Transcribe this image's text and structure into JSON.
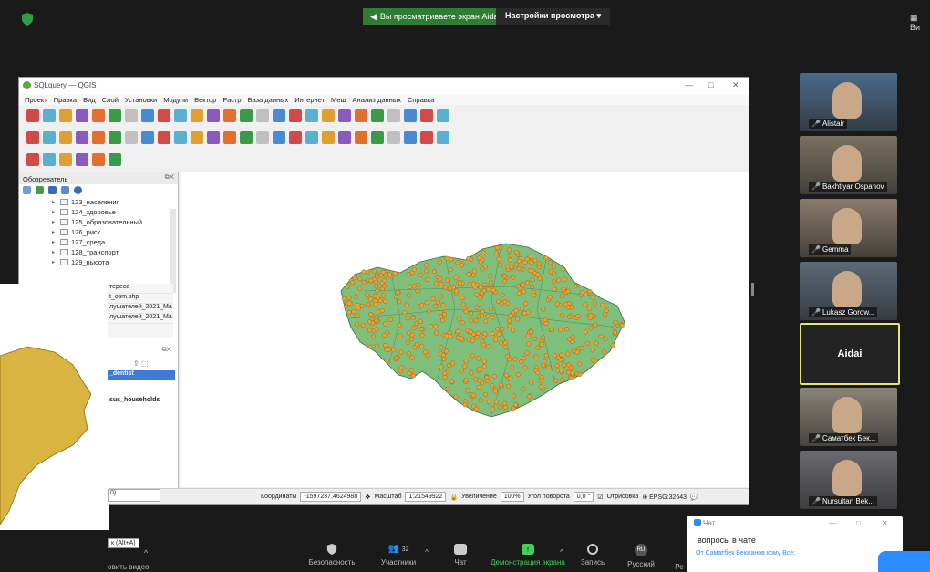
{
  "zoom": {
    "share_banner": "Вы просматриваете экран Aidai",
    "view_options": "Настройки просмотра",
    "view_label": "Ви"
  },
  "qgis": {
    "title": "SQLquery — QGIS",
    "menu": [
      "Проект",
      "Правка",
      "Вид",
      "Слой",
      "Установки",
      "Модули",
      "Вектор",
      "Растр",
      "База данных",
      "Интернет",
      "Меш",
      "Анализ данных",
      "Справка"
    ],
    "browser_title": "Обозреватель",
    "tree": [
      "123_населения",
      "124_здоровье",
      "125_образовательный",
      "126_риск",
      "127_среда",
      "128_транспорт",
      "129_высота"
    ],
    "status": {
      "coord_label": "Координаты",
      "coord_value": "-1597237,4624988",
      "scale_label": "Масштаб",
      "scale_value": "1:21549922",
      "zoom_label": "Увеличение",
      "zoom_value": "100%",
      "rotation_label": "Угол поворота",
      "rotation_value": "0,0 °",
      "render_label": "Отрисовка",
      "crs": "EPSG:32643"
    }
  },
  "left_window": {
    "list": [
      "тереса",
      "t_osm.shp",
      "лушателей_2021_Ма",
      "лушателей_2021_Ма"
    ],
    "layer_selected": "_dentist",
    "layer_other": "sus_households",
    "coord_partial": "0)"
  },
  "participants": [
    {
      "name": "Alistair",
      "bg": "#4a6a8a"
    },
    {
      "name": "Bakhtiyar Ospanov",
      "bg": "#7a7060"
    },
    {
      "name": "Gemma",
      "bg": "#8a7a6a"
    },
    {
      "name": "Lukasz Gorow...",
      "bg": "#5a6a78"
    },
    {
      "name": "Aidai",
      "bg": "#232323"
    },
    {
      "name": "Саматбек Бек...",
      "bg": "#8a8478"
    },
    {
      "name": "Nursultan Bek...",
      "bg": "#6a6a70"
    }
  ],
  "bottom": {
    "tooltip": "к (Alt+A)",
    "video": "овить видео",
    "security": "Безопасность",
    "participants": "Участники",
    "participant_count": "32",
    "chat": "Чат",
    "share": "Демонстрация экрана",
    "record": "Запись",
    "lang_badge": "RU",
    "lang": "Русский",
    "re": "Ре"
  },
  "chat": {
    "title": "Чат",
    "question": "вопросы в чате",
    "from": "От Саматбек Бекжанов кому Все:"
  },
  "colors": {
    "accent": "#2d8cff",
    "share_green": "#2e7d32",
    "map_fill": "#7fbf7b",
    "points": "#f0a030",
    "gold": "#d9b441"
  }
}
